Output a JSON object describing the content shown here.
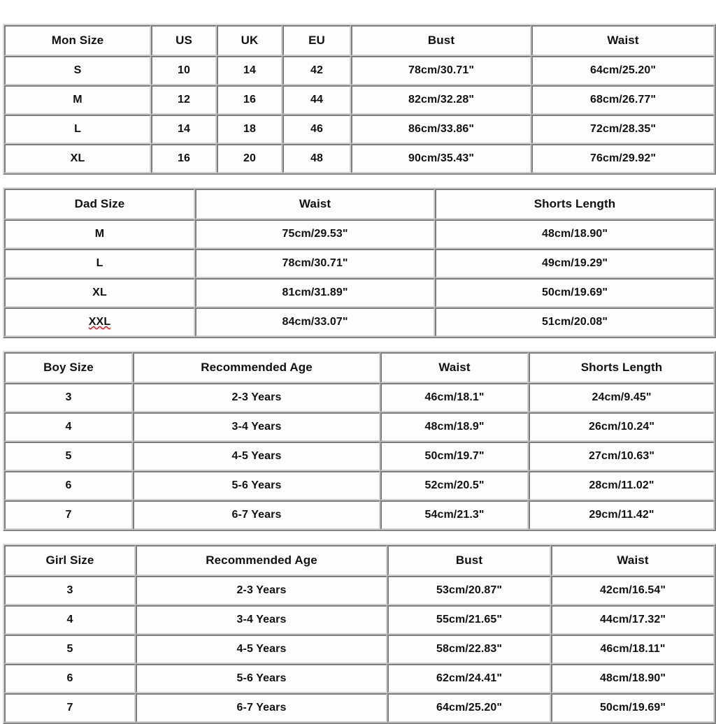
{
  "page": {
    "background_color": "#ffffff",
    "text_color": "#111111",
    "border_color": "#d0d0d0",
    "spellcheck_underline_color": "#e01b1b"
  },
  "tables": [
    {
      "id": "mon-size-table",
      "name": "mom-size-chart",
      "headers": [
        "Mon Size",
        "US",
        "UK",
        "EU",
        "Bust",
        "Waist"
      ],
      "rows": [
        [
          "S",
          "10",
          "14",
          "42",
          "78cm/30.71\"",
          "64cm/25.20\""
        ],
        [
          "M",
          "12",
          "16",
          "44",
          "82cm/32.28\"",
          "68cm/26.77\""
        ],
        [
          "L",
          "14",
          "18",
          "46",
          "86cm/33.86\"",
          "72cm/28.35\""
        ],
        [
          "XL",
          "16",
          "20",
          "48",
          "90cm/35.43\"",
          "76cm/29.92\""
        ]
      ]
    },
    {
      "id": "dad-size-table",
      "name": "dad-size-chart",
      "headers": [
        "Dad Size",
        "Waist",
        "Shorts Length"
      ],
      "rows": [
        [
          "M",
          "75cm/29.53\"",
          "48cm/18.90\""
        ],
        [
          "L",
          "78cm/30.71\"",
          "49cm/19.29\""
        ],
        [
          "XL",
          "81cm/31.89\"",
          "50cm/19.69\""
        ],
        [
          "XXL",
          "84cm/33.07\"",
          "51cm/20.08\""
        ]
      ],
      "misspelled_cells": [
        [
          3,
          0
        ]
      ]
    },
    {
      "id": "boy-size-table",
      "name": "boy-size-chart",
      "headers": [
        "Boy Size",
        "Recommended Age",
        "Waist",
        "Shorts Length"
      ],
      "rows": [
        [
          "3",
          "2-3 Years",
          "46cm/18.1\"",
          "24cm/9.45\""
        ],
        [
          "4",
          "3-4 Years",
          "48cm/18.9\"",
          "26cm/10.24\""
        ],
        [
          "5",
          "4-5 Years",
          "50cm/19.7\"",
          "27cm/10.63\""
        ],
        [
          "6",
          "5-6 Years",
          "52cm/20.5\"",
          "28cm/11.02\""
        ],
        [
          "7",
          "6-7 Years",
          "54cm/21.3\"",
          "29cm/11.42\""
        ]
      ]
    },
    {
      "id": "girl-size-table",
      "name": "girl-size-chart",
      "headers": [
        "Girl Size",
        "Recommended Age",
        "Bust",
        "Waist"
      ],
      "rows": [
        [
          "3",
          "2-3 Years",
          "53cm/20.87\"",
          "42cm/16.54\""
        ],
        [
          "4",
          "3-4 Years",
          "55cm/21.65\"",
          "44cm/17.32\""
        ],
        [
          "5",
          "4-5 Years",
          "58cm/22.83\"",
          "46cm/18.11\""
        ],
        [
          "6",
          "5-6 Years",
          "62cm/24.41\"",
          "48cm/18.90\""
        ],
        [
          "7",
          "6-7 Years",
          "64cm/25.20\"",
          "50cm/19.69\""
        ]
      ]
    }
  ]
}
